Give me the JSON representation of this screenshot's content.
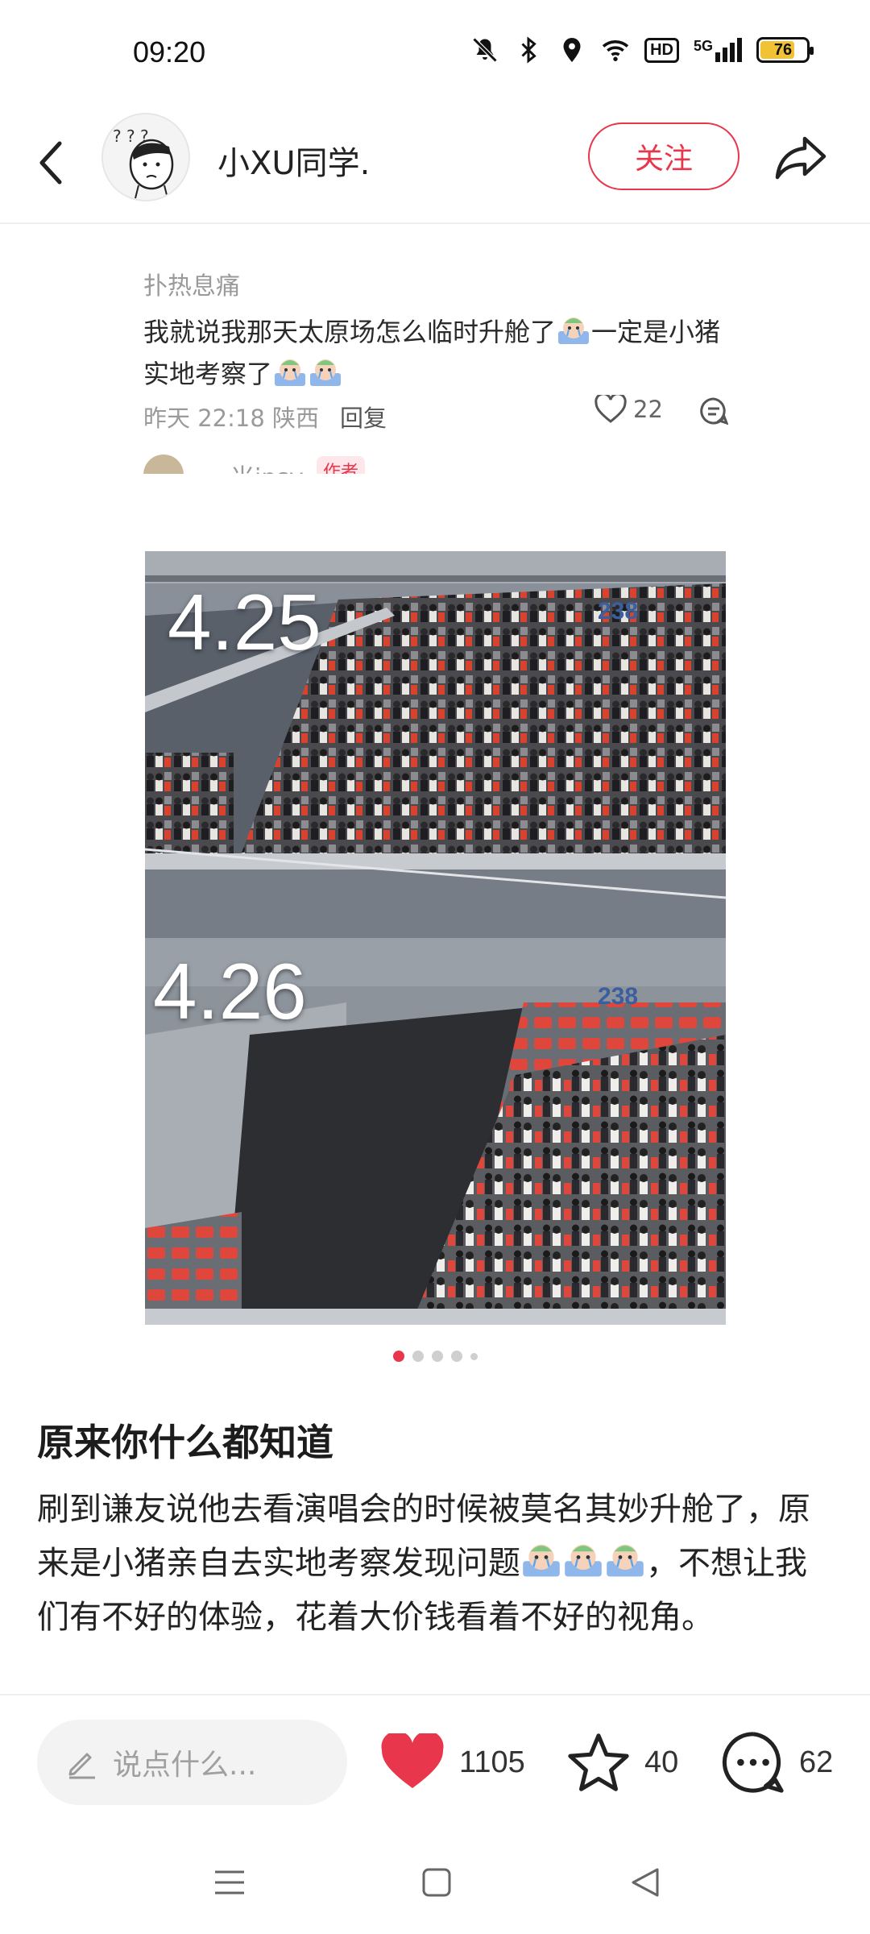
{
  "status_bar": {
    "time": "09:20",
    "icons": [
      "mute-bell-icon",
      "bluetooth-icon",
      "location-icon",
      "wifi-icon",
      "hd-icon",
      "5g-signal-icon",
      "battery-icon"
    ],
    "hd_label": "HD",
    "network_label": "5G",
    "battery_level": 76,
    "battery_text": "76",
    "battery_color": "#f0c234"
  },
  "header": {
    "username": "小XU同学.",
    "follow_label": "关注",
    "accent_color": "#e8364c"
  },
  "comment": {
    "author": "扑热息痛",
    "text_part1": "我就说我那天太原场怎么临时升舱了",
    "text_part2": "一定是小猪实地考察了",
    "time": "昨天 22:18 陕西",
    "reply_label": "回复",
    "like_count": "22",
    "next_author": "米ipsy",
    "next_tag": "作者"
  },
  "photo": {
    "label_top": "4.25",
    "label_bottom": "4.26",
    "section_top": "238",
    "section_bottom": "238"
  },
  "carousel": {
    "count": 5,
    "active_index": 0
  },
  "post": {
    "title": "原来你什么都知道",
    "body_part1": "刷到谦友说他去看演唱会的时候被莫名其妙升舱了，原来是小猪亲自去实地考察发现问题",
    "body_part2": "，不想让我们有不好的体验，花着大价钱看着不好的视角。"
  },
  "action_bar": {
    "input_placeholder": "说点什么...",
    "like_count": "1105",
    "star_count": "40",
    "comment_count": "62",
    "like_color": "#e8364c"
  }
}
